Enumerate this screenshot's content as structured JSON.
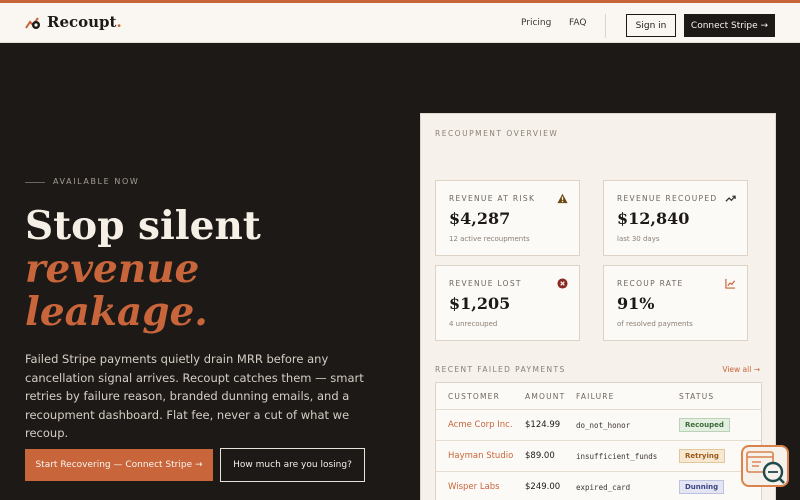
{
  "nav": {
    "logo": "Recoupt",
    "logo_dot": ".",
    "links": [
      "Pricing",
      "FAQ"
    ],
    "signin": "Sign in",
    "connect": "Connect Stripe →"
  },
  "hero": {
    "eyebrow": "AVAILABLE NOW",
    "title_line1": "Stop silent",
    "title_line2": "revenue",
    "title_line3": "leakage.",
    "description": "Failed Stripe payments quietly drain MRR before any cancellation signal arrives. Recoupt catches them — smart retries by failure reason, branded dunning emails, and a recoupment dashboard. Flat fee, never a cut of what we recoup.",
    "cta_primary": "Start Recovering — Connect Stripe →",
    "cta_secondary": "How much are you losing?"
  },
  "overview": {
    "title": "RECOUPMENT OVERVIEW",
    "cards": [
      {
        "label": "REVENUE AT RISK",
        "value": "$4,287",
        "sub": "12 active recoupments",
        "icon": "warning-icon"
      },
      {
        "label": "REVENUE RECOUPED",
        "value": "$12,840",
        "sub": "last 30 days",
        "icon": "trending-up-icon"
      },
      {
        "label": "REVENUE LOST",
        "value": "$1,205",
        "sub": "4 unrecouped",
        "icon": "x-circle-icon"
      },
      {
        "label": "RECOUP RATE",
        "value": "91%",
        "sub": "of resolved payments",
        "icon": "line-chart-icon"
      }
    ],
    "recent_title": "RECENT FAILED PAYMENTS",
    "view_all": "View all →",
    "columns": [
      "CUSTOMER",
      "AMOUNT",
      "FAILURE",
      "STATUS"
    ],
    "rows": [
      {
        "customer": "Acme Corp Inc.",
        "amount": "$124.99",
        "failure": "do_not_honor",
        "status": "Recouped"
      },
      {
        "customer": "Hayman Studio",
        "amount": "$89.00",
        "failure": "insufficient_funds",
        "status": "Retrying"
      },
      {
        "customer": "Wisper Labs",
        "amount": "$249.00",
        "failure": "expired_card",
        "status": "Dunning"
      }
    ]
  },
  "colors": {
    "accent": "#c8653a",
    "dark": "#1c1917",
    "panel": "#f6f1ea",
    "recouped": "#3b6b3a",
    "retrying": "#9a5a1c",
    "dunning": "#3c4584"
  }
}
